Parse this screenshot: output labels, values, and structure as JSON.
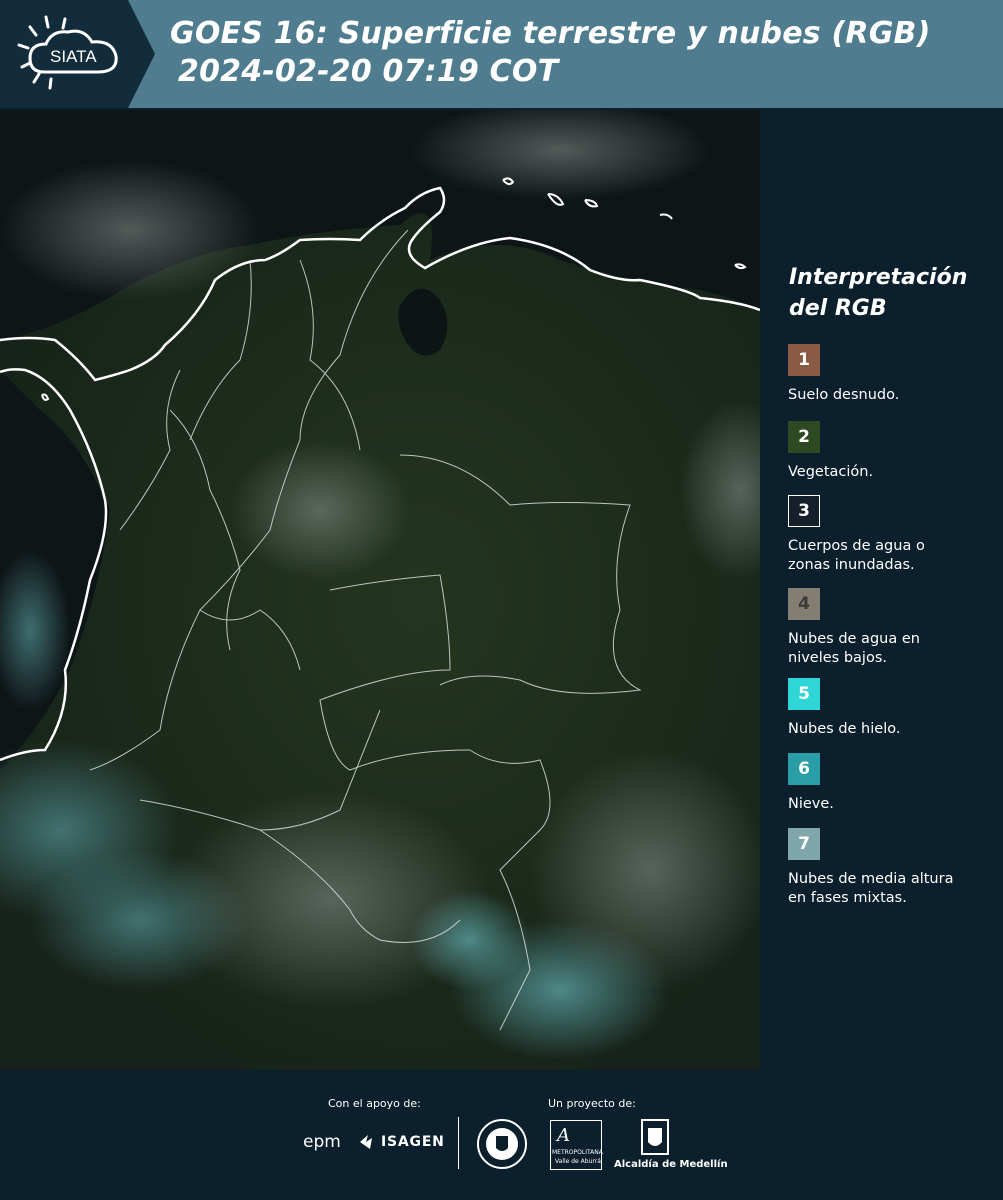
{
  "header": {
    "logo_text": "SIATA",
    "title_line1": "GOES 16: Superficie terrestre y nubes (RGB)",
    "title_line2": "2024-02-20 07:19 COT"
  },
  "legend": {
    "title": "Interpretación del RGB",
    "items": [
      {
        "number": "1",
        "label": "Suelo desnudo.",
        "color": "#8a5a44"
      },
      {
        "number": "2",
        "label": "Vegetación.",
        "color": "#2e4a22"
      },
      {
        "number": "3",
        "label": "Cuerpos de agua o zonas inundadas.",
        "color": "#15202a"
      },
      {
        "number": "4",
        "label": "Nubes de agua en niveles bajos.",
        "color": "#847d72"
      },
      {
        "number": "5",
        "label": "Nubes de hielo.",
        "color": "#2fd6d8"
      },
      {
        "number": "6",
        "label": "Nieve.",
        "color": "#2a9ea6"
      },
      {
        "number": "7",
        "label": "Nubes de media altura en fases mixtas.",
        "color": "#7fa7ab"
      }
    ]
  },
  "footer": {
    "support_caption": "Con el apoyo de:",
    "project_caption": "Un proyecto de:",
    "sponsor_epm": "epm",
    "sponsor_isagen": "ISAGEN",
    "sponsor_area_line1": "METROPOLITANA",
    "sponsor_area_line2": "Valle de Aburrá",
    "sponsor_alcaldia": "Alcaldía de Medellín"
  },
  "colors": {
    "header_bg": "#4f7d8f",
    "panel_bg": "#0b1f2c"
  }
}
